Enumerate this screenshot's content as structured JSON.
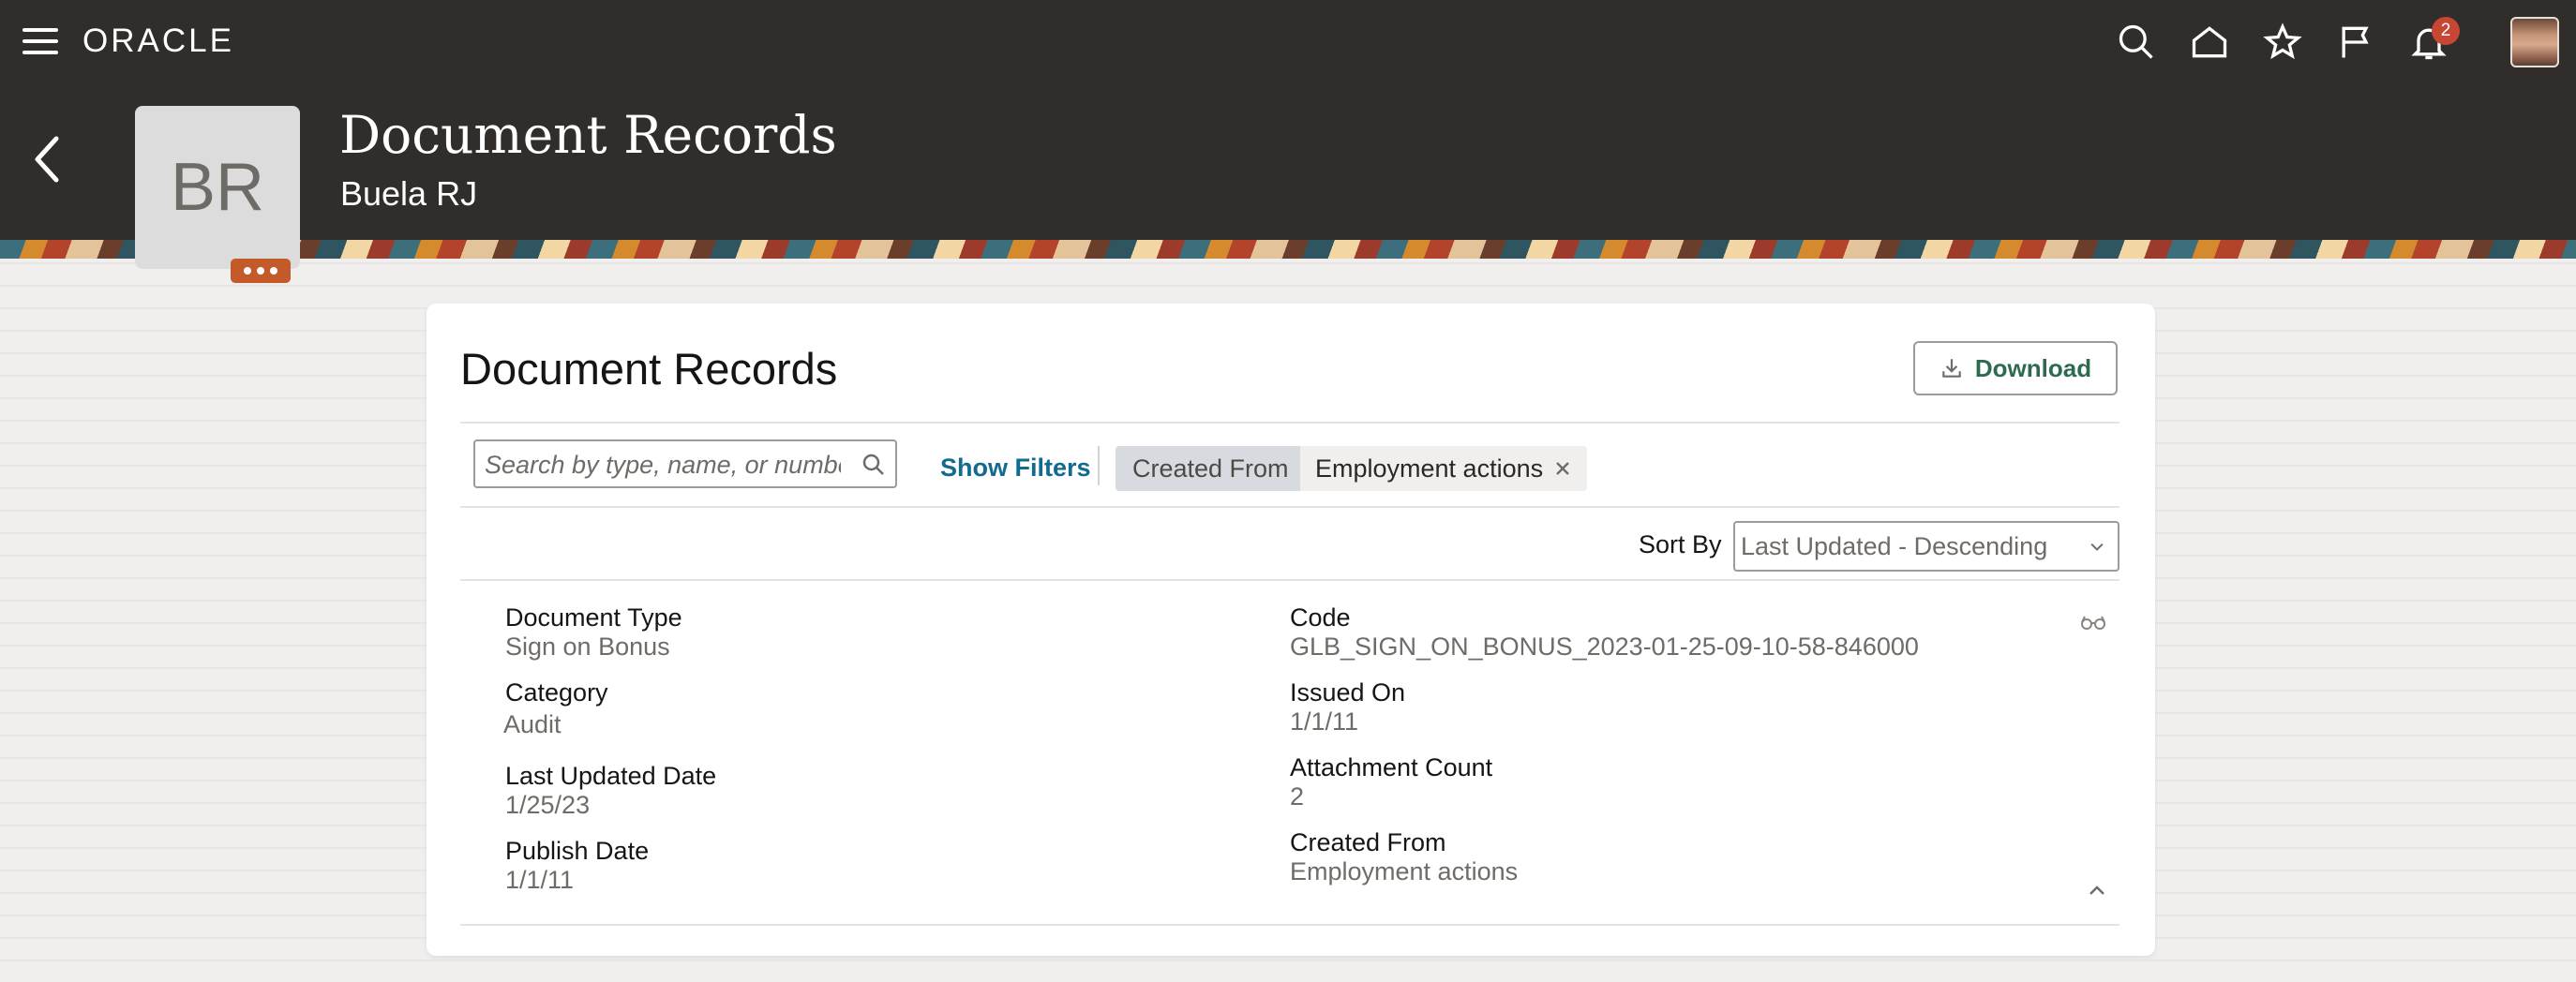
{
  "topbar": {
    "logo": "ORACLE",
    "notification_count": "2",
    "icons": [
      "menu-icon",
      "search-icon",
      "home-icon",
      "star-icon",
      "flag-icon",
      "bell-icon",
      "user-avatar"
    ]
  },
  "header": {
    "title": "Document Records",
    "subtitle": "Buela RJ",
    "initials": "BR"
  },
  "card": {
    "title": "Document Records",
    "download_label": "Download",
    "search_placeholder": "Search by type, name, or number",
    "show_filters": "Show Filters",
    "filter_chip": {
      "label": "Created From",
      "value": "Employment actions"
    },
    "sort_label": "Sort By",
    "sort_value": "Last Updated - Descending"
  },
  "record": {
    "left": [
      {
        "label": "Document Type",
        "value": "Sign on Bonus"
      },
      {
        "label": "Category",
        "value": "Audit"
      },
      {
        "label": "Last Updated Date",
        "value": "1/25/23"
      },
      {
        "label": "Publish Date",
        "value": "1/1/11"
      }
    ],
    "right": [
      {
        "label": "Code",
        "value": "GLB_SIGN_ON_BONUS_2023-01-25-09-10-58-846000"
      },
      {
        "label": "Issued On",
        "value": "1/1/11"
      },
      {
        "label": "Attachment Count",
        "value": "2"
      },
      {
        "label": "Created From",
        "value": "Employment actions"
      }
    ]
  },
  "colors": {
    "header_bg": "#312d2a",
    "link": "#116a8f",
    "download_text": "#2d6b4f",
    "badge": "#c74634"
  }
}
